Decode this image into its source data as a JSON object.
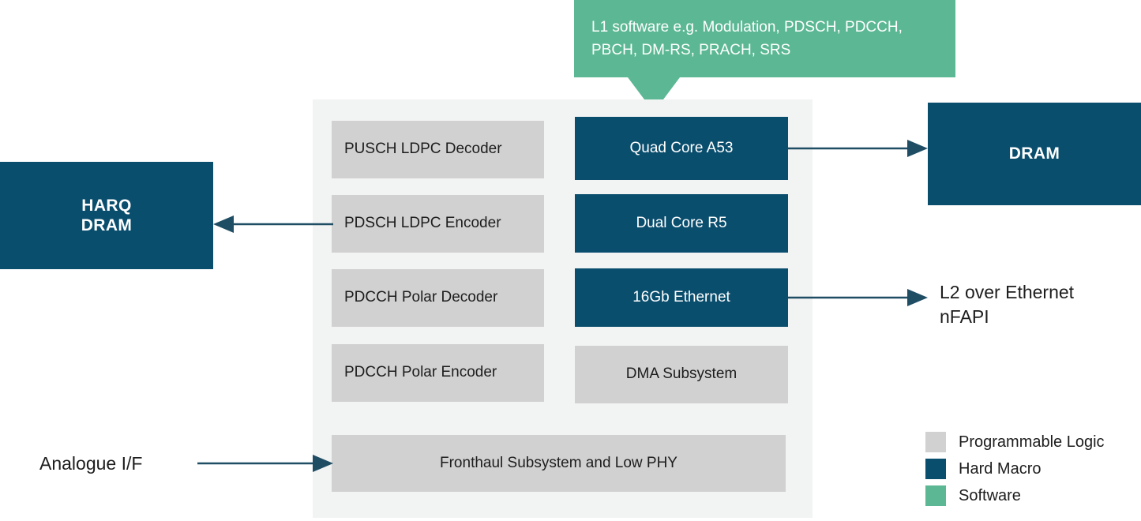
{
  "colors": {
    "programmable_logic": "#d1d1d1",
    "hard_macro": "#0a4e6e",
    "software": "#5cb894",
    "panel_background": "#f2f3f3",
    "arrow": "#1f4d63",
    "text_dark": "#1d1d1d",
    "text_light": "#ffffff"
  },
  "callout": {
    "text": "L1 software e.g. Modulation, PDSCH, PDCCH, PBCH, DM-RS, PRACH, SRS",
    "type": "software"
  },
  "soc_panel": {
    "programmable_logic_column": [
      {
        "label": "PUSCH LDPC Decoder",
        "type": "programmable-logic"
      },
      {
        "label": "PDSCH LDPC Encoder",
        "type": "programmable-logic"
      },
      {
        "label": "PDCCH Polar Decoder",
        "type": "programmable-logic"
      },
      {
        "label": "PDCCH Polar Encoder",
        "type": "programmable-logic"
      }
    ],
    "hard_macro_column": [
      {
        "label": "Quad Core A53",
        "type": "hard-macro"
      },
      {
        "label": "Dual Core R5",
        "type": "hard-macro"
      },
      {
        "label": "16Gb Ethernet",
        "type": "hard-macro"
      },
      {
        "label": "DMA Subsystem",
        "type": "programmable-logic"
      }
    ],
    "bottom_block": {
      "label": "Fronthaul Subsystem and Low PHY",
      "type": "programmable-logic"
    }
  },
  "external_blocks": {
    "harq_dram": {
      "label": "HARQ\nDRAM",
      "type": "hard-macro"
    },
    "dram": {
      "label": "DRAM",
      "type": "hard-macro"
    }
  },
  "labels": {
    "analogue_if": "Analogue I/F",
    "l2_over_ethernet": "L2 over Ethernet\nnFAPI"
  },
  "legend": {
    "items": [
      {
        "label": "Programmable Logic",
        "color": "#d1d1d1"
      },
      {
        "label": "Hard Macro",
        "color": "#0a4e6e"
      },
      {
        "label": "Software",
        "color": "#5cb894"
      }
    ]
  }
}
